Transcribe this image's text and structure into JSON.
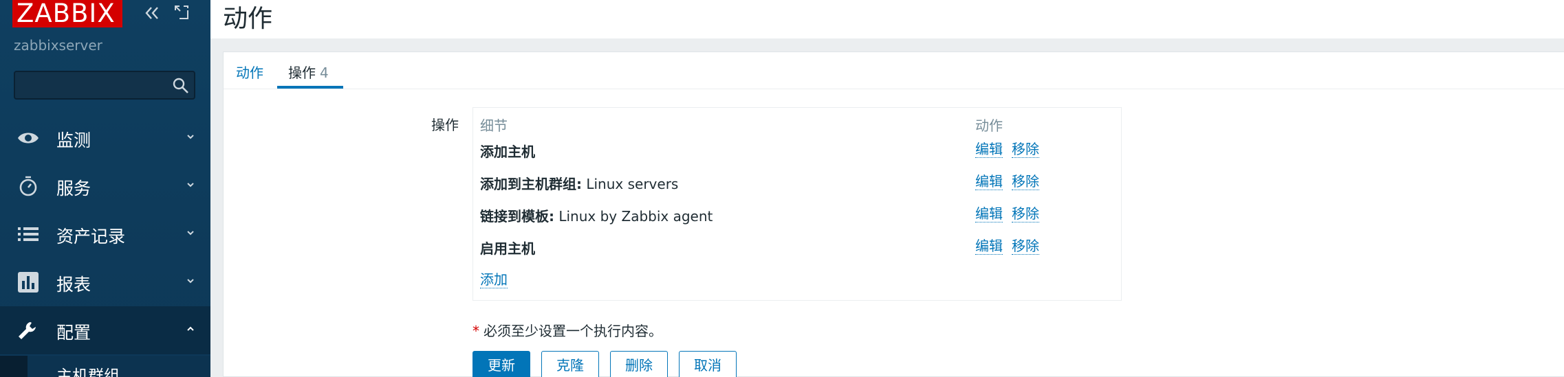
{
  "sidebar": {
    "logo": "ZABBIX",
    "server": "zabbixserver",
    "search": {
      "value": "",
      "placeholder": ""
    },
    "items": [
      {
        "label": "监测",
        "icon": "eye-icon"
      },
      {
        "label": "服务",
        "icon": "stopwatch-icon"
      },
      {
        "label": "资产记录",
        "icon": "list-icon"
      },
      {
        "label": "报表",
        "icon": "bar-chart-icon"
      },
      {
        "label": "配置",
        "icon": "wrench-icon"
      }
    ],
    "sub_item": "主机群组"
  },
  "header": {
    "title": "动作"
  },
  "tabs": [
    {
      "label": "动作"
    },
    {
      "label": "操作",
      "count": "4"
    }
  ],
  "form": {
    "field_label": "操作",
    "columns": {
      "detail": "细节",
      "action": "动作"
    },
    "operations": [
      {
        "name": "添加主机",
        "value": ""
      },
      {
        "name": "添加到主机群组:",
        "value": " Linux servers"
      },
      {
        "name": "链接到模板:",
        "value": " Linux by Zabbix agent"
      },
      {
        "name": "启用主机",
        "value": ""
      }
    ],
    "edit_label": "编辑",
    "remove_label": "移除",
    "add_label": "添加",
    "required_star": "*",
    "note": "必须至少设置一个执行内容。"
  },
  "buttons": {
    "update": "更新",
    "clone": "克隆",
    "delete": "删除",
    "cancel": "取消"
  },
  "colors": {
    "sidebar": "#0e3b5b",
    "logo": "#d40000",
    "link": "#0275b8",
    "primary": "#0275b8"
  }
}
